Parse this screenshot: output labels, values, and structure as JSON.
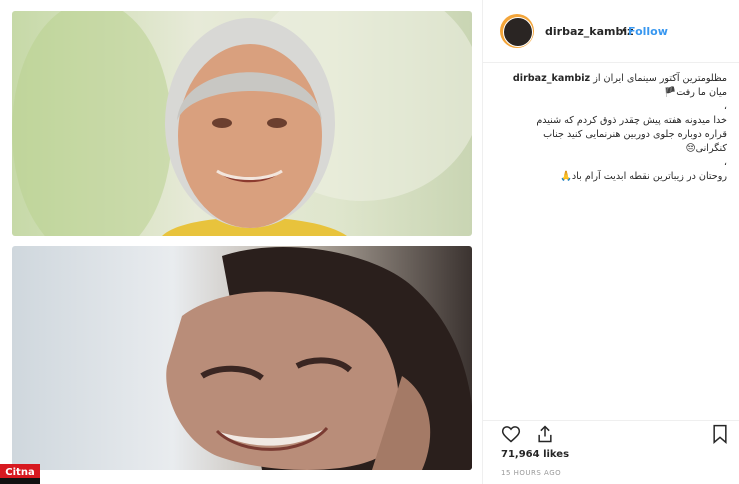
{
  "post": {
    "username": "dirbaz_kambiz",
    "separator": "•",
    "follow_label": "Follow",
    "caption_lines": [
      "مظلومترین آکتور سینمای ایران از",
      "میان ما رفت🏴",
      "،",
      "خدا میدونه هفته پیش چقدر ذوق کردم که شنیدم",
      "قراره دوباره جلوی دوربین هنرنمایی کنید جناب",
      "کنگرانی😔",
      "،",
      "روحتان در زیباترین نقطه ابدیت آرام باد🙏"
    ],
    "likes": "71,964 likes",
    "timestamp": "15 HOURS AGO"
  },
  "watermark": {
    "label": "Citna"
  },
  "colors": {
    "accent": "#3897f0",
    "text": "#262626",
    "muted": "#999999",
    "border": "#efefef",
    "watermark": "#d71920"
  },
  "icons": {
    "like": "heart-icon",
    "share": "share-icon",
    "save": "bookmark-icon"
  }
}
